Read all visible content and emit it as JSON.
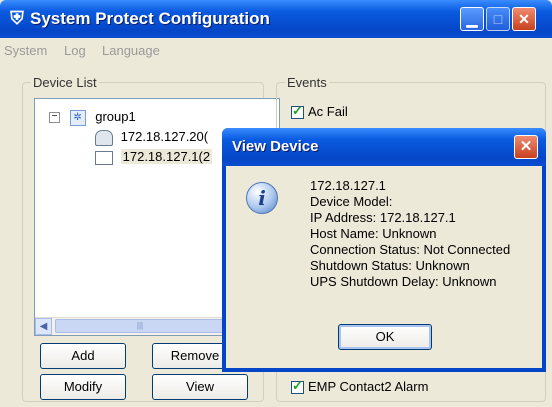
{
  "window": {
    "title": "System Protect Configuration"
  },
  "menu": {
    "items": [
      "System",
      "Log",
      "Language"
    ]
  },
  "device_list": {
    "legend": "Device List",
    "tree": {
      "group": "group1",
      "devices": [
        "172.18.127.20(",
        "172.18.127.1(2"
      ]
    }
  },
  "buttons": {
    "add": "Add",
    "remove": "Remove",
    "modify": "Modify",
    "view": "View"
  },
  "events": {
    "legend": "Events",
    "items": [
      {
        "label": "Ac Fail",
        "checked": true
      },
      {
        "label": "EMP Contact2 Alarm",
        "checked": true
      }
    ]
  },
  "dialog": {
    "title": "View Device",
    "lines": [
      "172.18.127.1",
      "Device Model:",
      "IP Address: 172.18.127.1",
      "Host Name: Unknown",
      "Connection Status: Not Connected",
      "Shutdown Status: Unknown",
      "UPS Shutdown Delay: Unknown"
    ],
    "ok_label": "OK"
  }
}
